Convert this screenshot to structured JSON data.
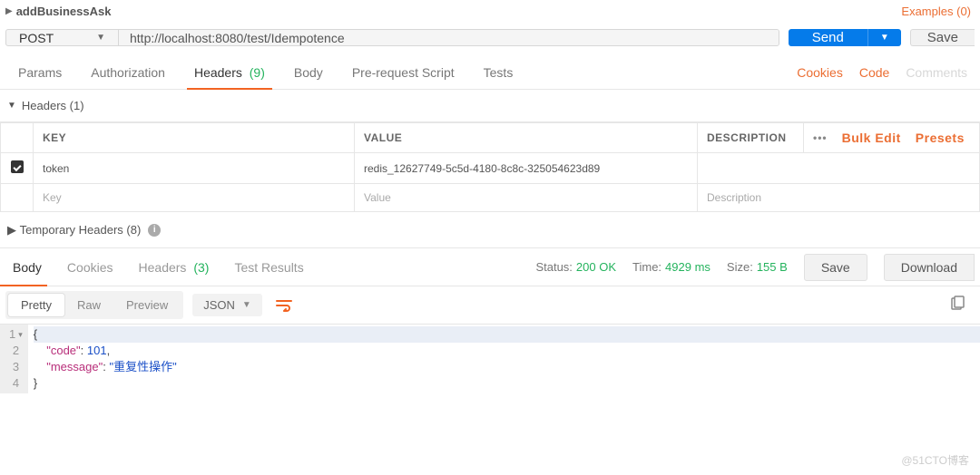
{
  "topbar": {
    "name": "addBusinessAsk",
    "examples_label": "Examples",
    "examples_count": "(0)"
  },
  "request": {
    "method": "POST",
    "url": "http://localhost:8080/test/Idempotence",
    "send_label": "Send",
    "save_label": "Save"
  },
  "tabs": {
    "params": "Params",
    "authorization": "Authorization",
    "headers": "Headers",
    "headers_count": "(9)",
    "body": "Body",
    "prerequest": "Pre-request Script",
    "tests": "Tests",
    "cookies": "Cookies",
    "code": "Code",
    "comments": "Comments"
  },
  "headers_section": {
    "title": "Headers",
    "count": "(1)",
    "col_key": "KEY",
    "col_value": "VALUE",
    "col_desc": "DESCRIPTION",
    "bulk_edit": "Bulk Edit",
    "presets": "Presets",
    "rows": [
      {
        "key": "token",
        "value": "redis_12627749-5c5d-4180-8c8c-325054623d89",
        "desc": ""
      }
    ],
    "ph_key": "Key",
    "ph_value": "Value",
    "ph_desc": "Description",
    "temp_label": "Temporary Headers",
    "temp_count": "(8)"
  },
  "response": {
    "tabs": {
      "body": "Body",
      "cookies": "Cookies",
      "headers": "Headers",
      "headers_count": "(3)",
      "tests": "Test Results"
    },
    "status_label": "Status:",
    "status_value": "200 OK",
    "time_label": "Time:",
    "time_value": "4929 ms",
    "size_label": "Size:",
    "size_value": "155 B",
    "save_label": "Save",
    "download_label": "Download",
    "views": {
      "pretty": "Pretty",
      "raw": "Raw",
      "preview": "Preview",
      "fmt": "JSON"
    },
    "body_json": {
      "code": 101,
      "message": "重复性操作"
    }
  },
  "chart_data": {
    "type": "table",
    "title": "Response JSON body",
    "columns": [
      "key",
      "value"
    ],
    "rows": [
      [
        "code",
        101
      ],
      [
        "message",
        "重复性操作"
      ]
    ]
  },
  "watermark": "@51CTO博客"
}
